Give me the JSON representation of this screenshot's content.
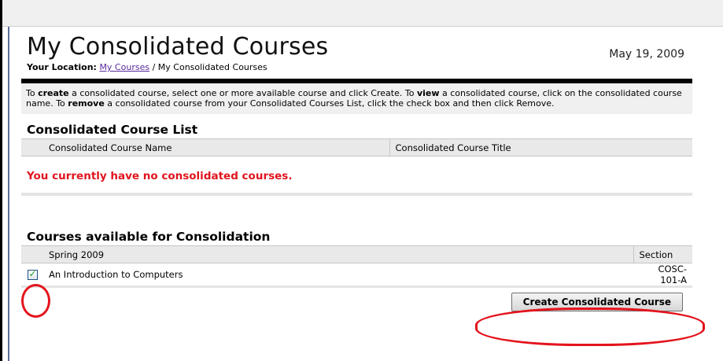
{
  "page": {
    "title": "My Consolidated Courses",
    "date": "May 19, 2009"
  },
  "breadcrumb": {
    "label": "Your Location:",
    "link": "My Courses",
    "separator": " / ",
    "current": "My Consolidated Courses"
  },
  "instructions": {
    "p1": "To ",
    "b1": "create",
    "p2": " a consolidated course, select one or more available course and click Create. To ",
    "b2": "view",
    "p3": " a consolidated course, click on the consolidated course name. To ",
    "b3": "remove",
    "p4": " a consolidated course from your Consolidated Courses List, click the check box and then click Remove."
  },
  "consolidated_list": {
    "title": "Consolidated Course List",
    "columns": [
      "Consolidated Course Name",
      "Consolidated Course Title"
    ],
    "empty_message": "You currently have no consolidated courses."
  },
  "available": {
    "title": "Courses available for Consolidation",
    "term_header": "Spring 2009",
    "section_header": "Section",
    "rows": [
      {
        "name": "An Introduction to Computers",
        "section": "COSC-101-A",
        "checked": true
      }
    ]
  },
  "actions": {
    "create_label": "Create Consolidated Course"
  },
  "colors": {
    "error_text": "#e0141e",
    "annotation_ink": "#e4131c",
    "link": "#5a2b9e"
  }
}
